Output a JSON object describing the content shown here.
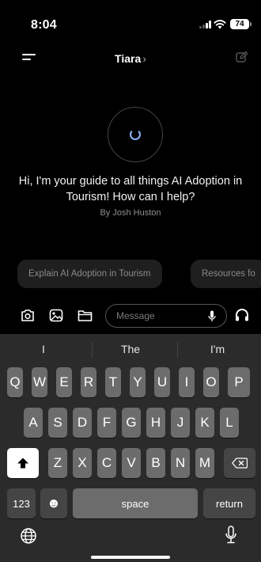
{
  "status": {
    "time": "8:04",
    "battery": "74"
  },
  "nav": {
    "title": "Tiara",
    "title_chevron": "›"
  },
  "assistant": {
    "greeting": "Hi, I'm your guide to all things AI Adoption in Tourism! How can I help?",
    "byline": "By Josh Huston"
  },
  "suggestions": [
    {
      "label": "Explain AI Adoption in Tourism"
    },
    {
      "label": "Resources fo"
    }
  ],
  "composer": {
    "placeholder": "Message"
  },
  "keyboard": {
    "predictions": [
      "I",
      "The",
      "I'm"
    ],
    "row1": [
      "Q",
      "W",
      "E",
      "R",
      "T",
      "Y",
      "U",
      "I",
      "O",
      "P"
    ],
    "row2": [
      "A",
      "S",
      "D",
      "F",
      "G",
      "H",
      "J",
      "K",
      "L"
    ],
    "row3": [
      "Z",
      "X",
      "C",
      "V",
      "B",
      "N",
      "M"
    ],
    "numbers_label": "123",
    "emoji_glyph": "☻",
    "space_label": "space",
    "return_label": "return"
  }
}
